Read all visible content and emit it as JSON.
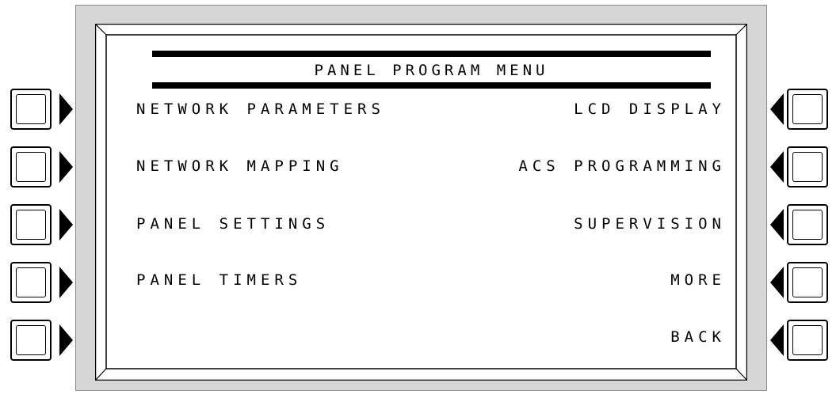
{
  "menu": {
    "title": "PANEL PROGRAM MENU",
    "left_items": [
      {
        "label": "NETWORK PARAMETERS"
      },
      {
        "label": "NETWORK MAPPING"
      },
      {
        "label": "PANEL SETTINGS"
      },
      {
        "label": "PANEL TIMERS"
      }
    ],
    "right_items": [
      {
        "label": "LCD DISPLAY"
      },
      {
        "label": "ACS PROGRAMMING"
      },
      {
        "label": "SUPERVISION"
      },
      {
        "label": "MORE"
      },
      {
        "label": "BACK"
      }
    ]
  },
  "softkeys": {
    "left_count": 5,
    "right_count": 5
  },
  "colors": {
    "frame": "#d6d6d6",
    "screen": "#ffffff",
    "text": "#000000"
  }
}
